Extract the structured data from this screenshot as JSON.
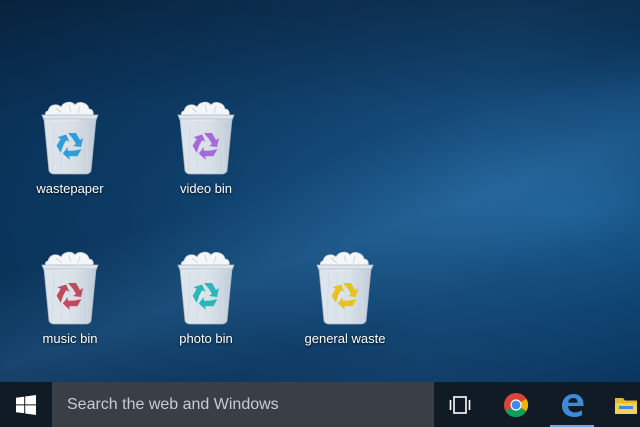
{
  "desktop": {
    "icons": [
      {
        "label": "wastepaper",
        "icon": "recycle-bin-icon",
        "accent": "#2f9ed8"
      },
      {
        "label": "video bin",
        "icon": "recycle-bin-icon",
        "accent": "#a46ad8"
      },
      {
        "label": "music bin",
        "icon": "recycle-bin-icon",
        "accent": "#c24a5e"
      },
      {
        "label": "photo bin",
        "icon": "recycle-bin-icon",
        "accent": "#28b8b8"
      },
      {
        "label": "general waste",
        "icon": "recycle-bin-icon",
        "accent": "#e8c21e"
      }
    ]
  },
  "taskbar": {
    "start_icon": "windows-logo-icon",
    "search": {
      "placeholder": "Search the web and Windows"
    },
    "icons": [
      "task-view-icon",
      "chrome-icon",
      "edge-icon",
      "file-explorer-icon"
    ],
    "background": "#101b26",
    "search_background": "#3a3f45"
  }
}
